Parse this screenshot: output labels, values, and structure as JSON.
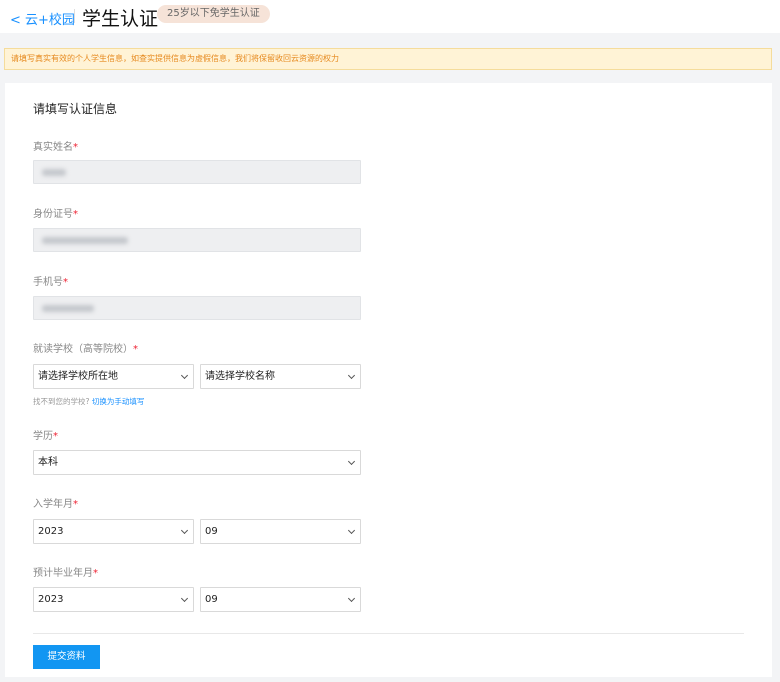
{
  "header": {
    "back_label": "< 云+校园",
    "title": "学生认证",
    "badge": "25岁以下免学生认证"
  },
  "notice": "请填写真实有效的个人学生信息，如查实提供信息为虚假信息，我们将保留收回云资源的权力",
  "form": {
    "section_title": "请填写认证信息",
    "required_mark": "*",
    "real_name": {
      "label": "真实姓名"
    },
    "id_number": {
      "label": "身份证号"
    },
    "phone": {
      "label": "手机号"
    },
    "school": {
      "label": "就读学校（高等院校）",
      "location_select": "请选择学校所在地",
      "name_select": "请选择学校名称",
      "hint": "找不到您的学校?",
      "hint_link": "切换为手动填写"
    },
    "education": {
      "label": "学历",
      "value": "本科"
    },
    "enrollment": {
      "label": "入学年月",
      "year": "2023",
      "month": "09"
    },
    "graduation": {
      "label": "预计毕业年月",
      "year": "2023",
      "month": "09"
    },
    "submit_label": "提交资料"
  }
}
